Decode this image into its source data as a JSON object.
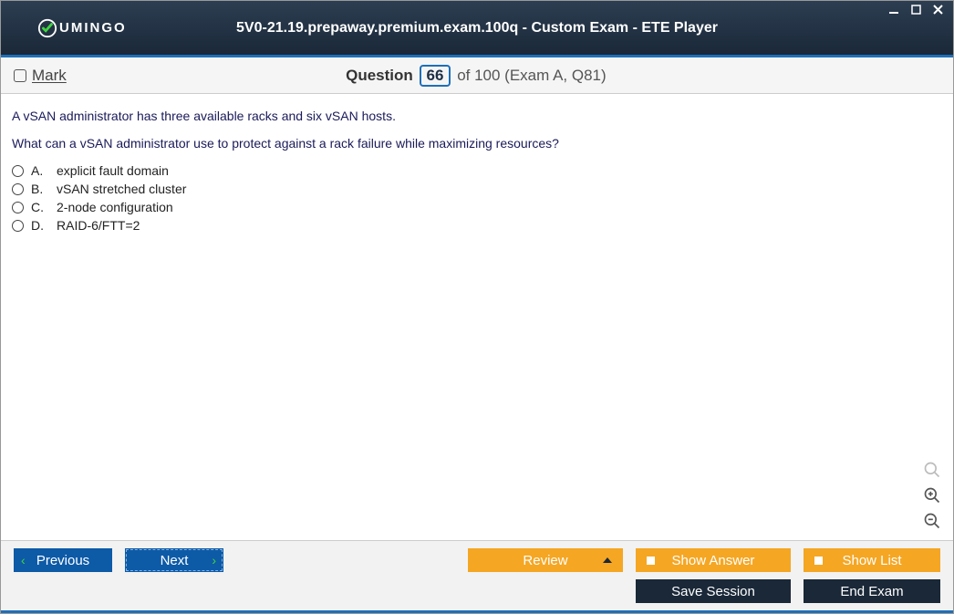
{
  "window": {
    "title": "5V0-21.19.prepaway.premium.exam.100q - Custom Exam - ETE Player",
    "logo_text": "UMINGO"
  },
  "infobar": {
    "mark_label": "Mark",
    "question_word": "Question",
    "question_num": "66",
    "question_rest": "of 100 (Exam A, Q81)"
  },
  "question": {
    "para1": "A vSAN administrator has three available racks and six vSAN hosts.",
    "para2": "What can a vSAN administrator use to protect against a rack failure while maximizing resources?",
    "options": [
      {
        "letter": "A.",
        "text": "explicit fault domain"
      },
      {
        "letter": "B.",
        "text": "vSAN stretched cluster"
      },
      {
        "letter": "C.",
        "text": "2-node configuration"
      },
      {
        "letter": "D.",
        "text": "RAID-6/FTT=2"
      }
    ]
  },
  "footer": {
    "previous": "Previous",
    "next": "Next",
    "review": "Review",
    "show_answer": "Show Answer",
    "show_list": "Show List",
    "save_session": "Save Session",
    "end_exam": "End Exam"
  }
}
